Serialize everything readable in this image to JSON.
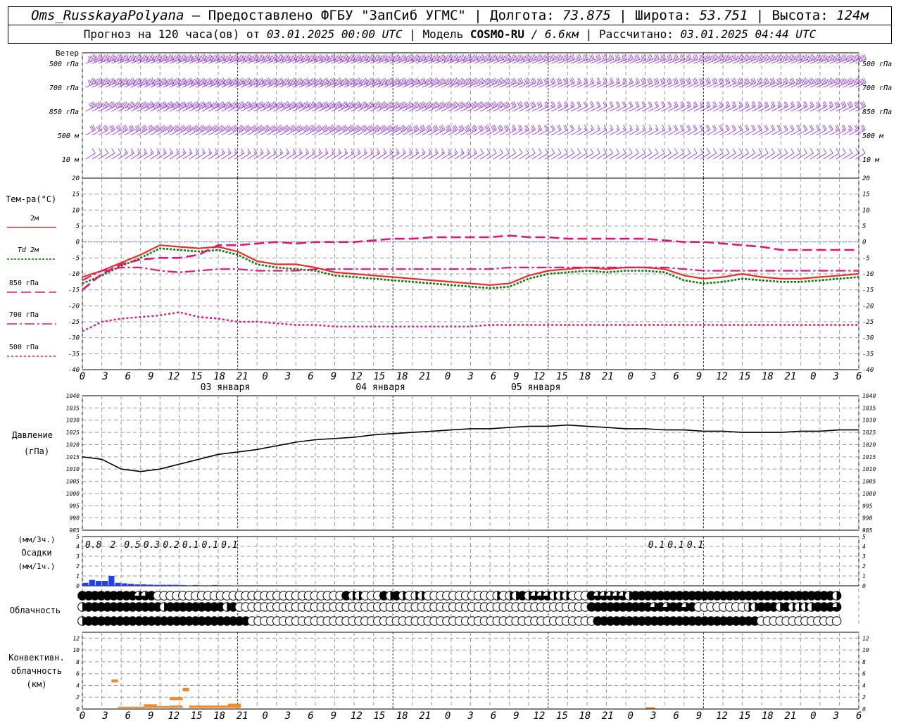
{
  "header": {
    "station": "Oms_RusskayaPolyana",
    "provider": "– Предоставлено ФГБУ \"ЗапСиб УГМС\"",
    "lon_label": "| Долгота:",
    "lon": "73.875",
    "lat_label": "| Широта:",
    "lat": "53.751",
    "alt_label": "| Высота:",
    "alt": "124м",
    "forecast_label": "Прогноз на 120 часа(ов) от",
    "forecast_start": "03.01.2025 00:00 UTC",
    "model_label": "| Модель",
    "model": "COSMO-RU",
    "model_res": "/ 6.6км",
    "computed_label": "| Рассчитано:",
    "computed": "03.01.2025 04:44 UTC"
  },
  "colors": {
    "wind": "#8a2be2",
    "t2m": "#ee2a2a",
    "td2m": "#0a7a0a",
    "t850": "#e0157a",
    "t700": "#e0157a",
    "t500": "#e0157a",
    "pressure": "#000000",
    "precip": "#1f3ff0",
    "convective": "#f08a2a",
    "zero_line": "#4060e0",
    "grid": "#9a9a9a"
  },
  "chart_data": [
    {
      "type": "wind_barbs",
      "name": "wind",
      "panel_label": "Ветер",
      "levels": [
        "500 гПа",
        "700 гПа",
        "850 гПа",
        "500 м",
        "10  м"
      ],
      "speed_kt": [
        [
          55,
          58,
          60,
          62,
          63,
          63,
          62,
          61,
          60,
          58,
          56,
          55,
          50,
          45,
          40,
          36,
          35,
          36,
          38,
          40,
          42,
          44,
          45,
          46,
          47
        ],
        [
          50,
          55,
          58,
          60,
          60,
          59,
          58,
          58,
          57,
          55,
          52,
          48,
          40,
          35,
          30,
          28,
          28,
          30,
          32,
          34,
          36,
          38,
          40,
          42,
          43
        ],
        [
          40,
          48,
          52,
          53,
          53,
          52,
          52,
          51,
          50,
          49,
          47,
          44,
          40,
          30,
          25,
          22,
          22,
          24,
          25,
          26,
          27,
          28,
          29,
          30,
          31
        ],
        [
          30,
          38,
          42,
          43,
          43,
          42,
          42,
          41,
          40,
          40,
          38,
          36,
          32,
          25,
          20,
          18,
          18,
          19,
          20,
          21,
          22,
          23,
          24,
          25,
          26
        ],
        [
          12,
          15,
          18,
          18,
          17,
          17,
          16,
          16,
          15,
          15,
          15,
          15,
          14,
          12,
          10,
          10,
          10,
          10,
          10,
          10,
          11,
          12,
          12,
          12,
          12
        ]
      ]
    },
    {
      "type": "line",
      "name": "temperature",
      "panel_label": "Тем-ра(°C)",
      "ylim": [
        -40,
        20
      ],
      "yticks": [
        20,
        15,
        10,
        5,
        0,
        -5,
        -10,
        -15,
        -20,
        -25,
        -30,
        -35,
        -40
      ],
      "x_hours": [
        0,
        3,
        6,
        9,
        12,
        15,
        18,
        21,
        24,
        27,
        30,
        33,
        36,
        39,
        42,
        45,
        48,
        51,
        54,
        57,
        60,
        63,
        66,
        69,
        72,
        75,
        78,
        81,
        84,
        87,
        90,
        93,
        96,
        99,
        102,
        105,
        108,
        111,
        114,
        117,
        120
      ],
      "series": [
        {
          "name": "2м",
          "values": [
            -11,
            -9,
            -6.5,
            -4,
            -1,
            -1.5,
            -2,
            -1.5,
            -3,
            -6,
            -7,
            -7,
            -8,
            -9.5,
            -10,
            -10.5,
            -11,
            -11.5,
            -12,
            -12.5,
            -13,
            -13.5,
            -13,
            -10.5,
            -9,
            -8.5,
            -8,
            -8.5,
            -8,
            -8,
            -8.5,
            -10.5,
            -11.5,
            -11,
            -10,
            -11,
            -11.5,
            -11.5,
            -11,
            -10.5,
            -10
          ]
        },
        {
          "name": "Td  2м",
          "values": [
            -13,
            -10.5,
            -7.5,
            -5,
            -2,
            -2.5,
            -3,
            -2.5,
            -4,
            -7,
            -8,
            -8.5,
            -9,
            -10.5,
            -11,
            -11.5,
            -12,
            -12.5,
            -13,
            -13.5,
            -14,
            -14.5,
            -14,
            -11.5,
            -10,
            -9.5,
            -9,
            -9.5,
            -9,
            -9,
            -9.5,
            -12,
            -13,
            -12.5,
            -11.5,
            -12,
            -12.5,
            -12.5,
            -12,
            -11.5,
            -11
          ]
        },
        {
          "name": "850 гПа",
          "values": [
            -15,
            -10,
            -7,
            -5.5,
            -5,
            -5,
            -4,
            -1,
            -1,
            -0.5,
            0,
            -0.5,
            0,
            0,
            0,
            0.5,
            1,
            1,
            1.5,
            1.5,
            1.5,
            1.5,
            2,
            1.5,
            1.5,
            1,
            1,
            1,
            1,
            1,
            0.5,
            0,
            0,
            -0.5,
            -1,
            -1.5,
            -2.5,
            -2.5,
            -2.5,
            -2.5,
            -2.5
          ]
        },
        {
          "name": "700 гПа",
          "values": [
            -12,
            -9,
            -8,
            -8,
            -9,
            -9.5,
            -9,
            -8.5,
            -8.5,
            -9,
            -9,
            -9,
            -8.5,
            -8.5,
            -8.5,
            -8.5,
            -8.5,
            -8.5,
            -8.5,
            -8.5,
            -8.5,
            -8.5,
            -8,
            -8,
            -8,
            -8,
            -8,
            -8,
            -8,
            -8,
            -8,
            -8.5,
            -9,
            -9,
            -9,
            -9,
            -9,
            -9,
            -9,
            -9,
            -9
          ]
        },
        {
          "name": "500 гПа",
          "values": [
            -28,
            -25,
            -24,
            -23.5,
            -23,
            -22,
            -23.5,
            -24,
            -25,
            -25,
            -25.5,
            -26,
            -26,
            -26.5,
            -26.5,
            -26.5,
            -26.5,
            -26.5,
            -26.5,
            -26.5,
            -26.5,
            -26,
            -26,
            -26,
            -26,
            -26,
            -26,
            -26,
            -26,
            -26,
            -26,
            -26,
            -26,
            -26,
            -26,
            -26,
            -26,
            -26,
            -26,
            -26,
            -26
          ]
        }
      ]
    },
    {
      "type": "line",
      "name": "pressure",
      "panel_label": "Давление",
      "panel_unit": "(гПа)",
      "ylim": [
        985,
        1040
      ],
      "yticks": [
        1040,
        1035,
        1030,
        1025,
        1020,
        1015,
        1010,
        1005,
        1000,
        995,
        990,
        985
      ],
      "x_hours": [
        0,
        3,
        6,
        9,
        12,
        15,
        18,
        21,
        24,
        27,
        30,
        33,
        36,
        39,
        42,
        45,
        48,
        51,
        54,
        57,
        60,
        63,
        66,
        69,
        72,
        75,
        78,
        81,
        84,
        87,
        90,
        93,
        96,
        99,
        102,
        105,
        108,
        111,
        114,
        117,
        120
      ],
      "values": [
        1015,
        1014,
        1010,
        1009,
        1010,
        1012,
        1014,
        1016,
        1017,
        1018,
        1019.5,
        1021,
        1022,
        1022.5,
        1023,
        1024,
        1024.5,
        1025,
        1025.5,
        1026,
        1026.5,
        1026.5,
        1027,
        1027.5,
        1027.5,
        1028,
        1027.5,
        1027,
        1026.5,
        1026.5,
        1026,
        1026,
        1025.5,
        1025.5,
        1025,
        1025,
        1025,
        1025.5,
        1025.5,
        1026,
        1026
      ]
    },
    {
      "type": "bar",
      "name": "precipitation",
      "panel_label": "Осадки",
      "unit_3h": "(мм/3ч.)",
      "unit_1h": "(мм/1ч.)",
      "ylim": [
        0,
        5
      ],
      "yticks": [
        5,
        4,
        3,
        2,
        1,
        0
      ],
      "hourly_bars": [
        {
          "x": 1,
          "v": 0.3
        },
        {
          "x": 2,
          "v": 0.6
        },
        {
          "x": 3,
          "v": 0.5
        },
        {
          "x": 4,
          "v": 0.5
        },
        {
          "x": 5,
          "v": 1.0
        },
        {
          "x": 6,
          "v": 0.3
        },
        {
          "x": 7,
          "v": 0.25
        },
        {
          "x": 8,
          "v": 0.2
        },
        {
          "x": 9,
          "v": 0.15
        },
        {
          "x": 10,
          "v": 0.15
        },
        {
          "x": 11,
          "v": 0.12
        },
        {
          "x": 12,
          "v": 0.1
        },
        {
          "x": 13,
          "v": 0.1
        },
        {
          "x": 14,
          "v": 0.1
        },
        {
          "x": 15,
          "v": 0.1
        },
        {
          "x": 16,
          "v": 0.08
        },
        {
          "x": 17,
          "v": 0.05
        },
        {
          "x": 18,
          "v": 0.08
        },
        {
          "x": 19,
          "v": 0.05
        },
        {
          "x": 20,
          "v": 0.05
        },
        {
          "x": 21,
          "v": 0.08
        },
        {
          "x": 22,
          "v": 0.05
        },
        {
          "x": 23,
          "v": 0.05
        },
        {
          "x": 24,
          "v": 0.03
        },
        {
          "x": 87,
          "v": 0.03
        },
        {
          "x": 89,
          "v": 0.03
        },
        {
          "x": 91,
          "v": 0.02
        },
        {
          "x": 93,
          "v": 0.02
        }
      ],
      "totals_3h": [
        {
          "x": 1.5,
          "label": "0.8"
        },
        {
          "x": 4.5,
          "label": "2"
        },
        {
          "x": 7.5,
          "label": "0.5"
        },
        {
          "x": 10.5,
          "label": "0.3"
        },
        {
          "x": 13.5,
          "label": "0.2"
        },
        {
          "x": 16.5,
          "label": "0.1"
        },
        {
          "x": 19.5,
          "label": "0.1"
        },
        {
          "x": 22.5,
          "label": "0.1"
        },
        {
          "x": 88.5,
          "label": "0.1"
        },
        {
          "x": 91.5,
          "label": "0.1"
        },
        {
          "x": 94.5,
          "label": "0.1"
        }
      ]
    },
    {
      "type": "symbols",
      "name": "cloudiness",
      "panel_label": "Облачность",
      "rows": [
        "1111111113310000000000000000000000000000001220001212022000000000002022123332220001333332111111111111111111111111111111112",
        "2111111111111211111111121000000000000000000000000000000000000000000000000000000001111111111313113100000000221112122221113",
        "2111111111111111111111111110000000000000000000000000000000000000000000000000000000111111111111111111111111110000000000000"
      ]
    },
    {
      "type": "bar",
      "name": "convective",
      "panel_label_lines": [
        "Конвективн.",
        "облачность",
        "(км)"
      ],
      "ylim": [
        0,
        13
      ],
      "yticks": [
        12,
        10,
        8,
        6,
        4,
        2,
        0
      ],
      "segments": [
        {
          "x0": 4.5,
          "x1": 5.5,
          "base": 4.5,
          "top": 5.0
        },
        {
          "x0": 5.5,
          "x1": 9.5,
          "base": 0.2,
          "top": 0.4
        },
        {
          "x0": 9.5,
          "x1": 11.5,
          "base": 0.2,
          "top": 0.8
        },
        {
          "x0": 11.5,
          "x1": 13.5,
          "base": 0.2,
          "top": 0.5
        },
        {
          "x0": 13.5,
          "x1": 15.5,
          "base": 0.2,
          "top": 0.6
        },
        {
          "x0": 13.5,
          "x1": 15.5,
          "base": 1.5,
          "top": 2.0
        },
        {
          "x0": 15.5,
          "x1": 16.5,
          "base": 3.0,
          "top": 3.6
        },
        {
          "x0": 16.5,
          "x1": 22.5,
          "base": 0.2,
          "top": 0.6
        },
        {
          "x0": 22.5,
          "x1": 24.5,
          "base": 0.2,
          "top": 0.9
        },
        {
          "x0": 87,
          "x1": 88.5,
          "base": 0.1,
          "top": 0.3
        }
      ]
    }
  ],
  "time_axis": {
    "hours_min": 0,
    "hours_max": 120,
    "tick_labels": [
      "0",
      "3",
      "6",
      "9",
      "12",
      "15",
      "18",
      "21",
      "0",
      "3",
      "6",
      "9",
      "12",
      "15",
      "18",
      "21",
      "0",
      "3",
      "6",
      "9",
      "12",
      "15",
      "18",
      "21",
      "0",
      "3",
      "6",
      "9",
      "12",
      "15",
      "18",
      "21",
      "0",
      "3",
      "6"
    ],
    "day_labels": [
      {
        "x": 21,
        "label": "03 января"
      },
      {
        "x": 45,
        "label": "04 января"
      },
      {
        "x": 69,
        "label": "05 января"
      }
    ]
  }
}
